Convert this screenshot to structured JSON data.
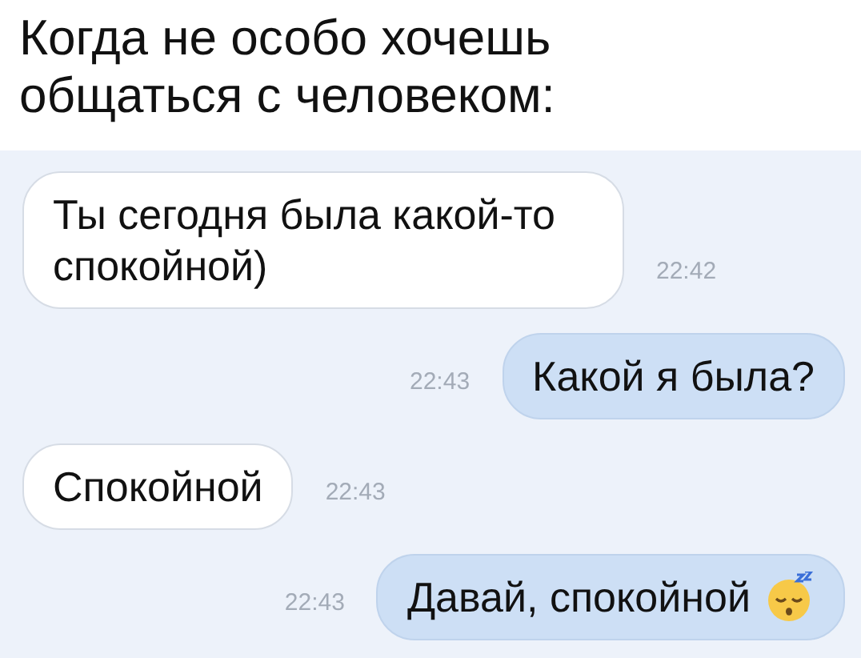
{
  "caption": "Когда не особо хочешь общаться с человеком:",
  "messages": [
    {
      "kind": "incoming",
      "text": "Ты сегодня была какой-то спокойной)",
      "time": "22:42",
      "emoji": false
    },
    {
      "kind": "outgoing",
      "text": "Какой я была?",
      "time": "22:43",
      "emoji": false
    },
    {
      "kind": "incoming",
      "text": "Спокойной",
      "time": "22:43",
      "emoji": false
    },
    {
      "kind": "outgoing",
      "text": "Давай, спокойной",
      "time": "22:43",
      "emoji": true
    }
  ]
}
